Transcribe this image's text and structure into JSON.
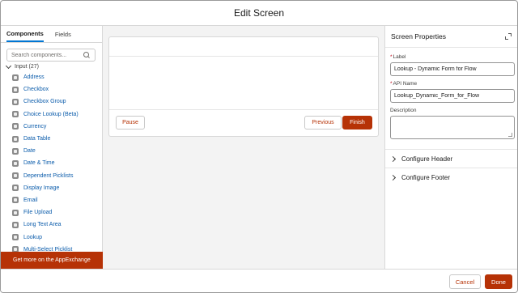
{
  "header": {
    "title": "Edit Screen"
  },
  "left_panel": {
    "tabs": [
      {
        "label": "Components"
      },
      {
        "label": "Fields"
      }
    ],
    "search": {
      "placeholder": "Search components..."
    },
    "section": {
      "label": "Input (27)"
    },
    "components": [
      {
        "label": "Address",
        "icon": "address-icon"
      },
      {
        "label": "Checkbox",
        "icon": "checkbox-icon"
      },
      {
        "label": "Checkbox Group",
        "icon": "checkbox-group-icon"
      },
      {
        "label": "Choice Lookup (Beta)",
        "icon": "choice-lookup-icon"
      },
      {
        "label": "Currency",
        "icon": "currency-icon"
      },
      {
        "label": "Data Table",
        "icon": "data-table-icon"
      },
      {
        "label": "Date",
        "icon": "date-icon"
      },
      {
        "label": "Date & Time",
        "icon": "datetime-icon"
      },
      {
        "label": "Dependent Picklists",
        "icon": "dependent-picklists-icon"
      },
      {
        "label": "Display Image",
        "icon": "display-image-icon"
      },
      {
        "label": "Email",
        "icon": "email-icon"
      },
      {
        "label": "File Upload",
        "icon": "file-upload-icon"
      },
      {
        "label": "Long Text Area",
        "icon": "long-text-area-icon"
      },
      {
        "label": "Lookup",
        "icon": "lookup-icon"
      },
      {
        "label": "Multi-Select Picklist",
        "icon": "multi-select-picklist-icon"
      }
    ],
    "appexchange_label": "Get more on the AppExchange"
  },
  "canvas": {
    "pause_label": "Pause",
    "previous_label": "Previous",
    "finish_label": "Finish"
  },
  "properties": {
    "title": "Screen Properties",
    "label_field": {
      "label": "Label",
      "value": "Lookup - Dynamic Form for Flow"
    },
    "api_field": {
      "label": "API Name",
      "value": "Lookup_Dynamic_Form_for_Flow"
    },
    "description_field": {
      "label": "Description",
      "value": ""
    },
    "sections": [
      {
        "label": "Configure Header"
      },
      {
        "label": "Configure Footer"
      }
    ]
  },
  "footer": {
    "cancel_label": "Cancel",
    "done_label": "Done"
  },
  "colors": {
    "brand": "#b63206",
    "link": "#0b5cab",
    "canvas_bg": "#f3f3f3"
  }
}
